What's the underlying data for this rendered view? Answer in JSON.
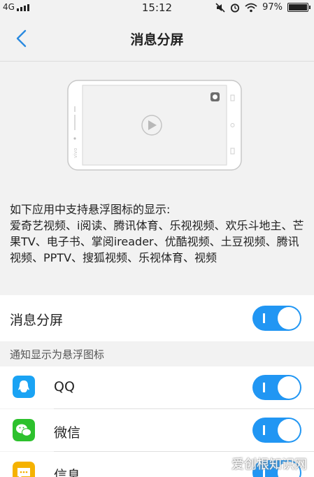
{
  "status_bar": {
    "network": "4G",
    "time": "15:12",
    "battery": "97%"
  },
  "header": {
    "title": "消息分屏"
  },
  "description": {
    "intro": "如下应用中支持悬浮图标的显示:",
    "apps_text": "爱奇艺视频、i阅读、腾讯体育、乐视视频、欢乐斗地主、芒果TV、电子书、掌阅ireader、优酷视频、土豆视频、腾讯视频、PPTV、搜狐视频、乐视体育、视频"
  },
  "main_toggle": {
    "label": "消息分屏",
    "on": true
  },
  "section": {
    "header": "通知显示为悬浮图标"
  },
  "apps": [
    {
      "label": "QQ",
      "icon": "qq-icon",
      "color": "#1aa3f4",
      "on": true
    },
    {
      "label": "微信",
      "icon": "wechat-icon",
      "color": "#2dc12d",
      "on": true
    },
    {
      "label": "信息",
      "icon": "message-icon",
      "color": "#f5b200",
      "on": true
    }
  ],
  "colors": {
    "accent": "#2196f3",
    "back_arrow": "#2a8ae0"
  },
  "watermark": "爱创根知识网"
}
